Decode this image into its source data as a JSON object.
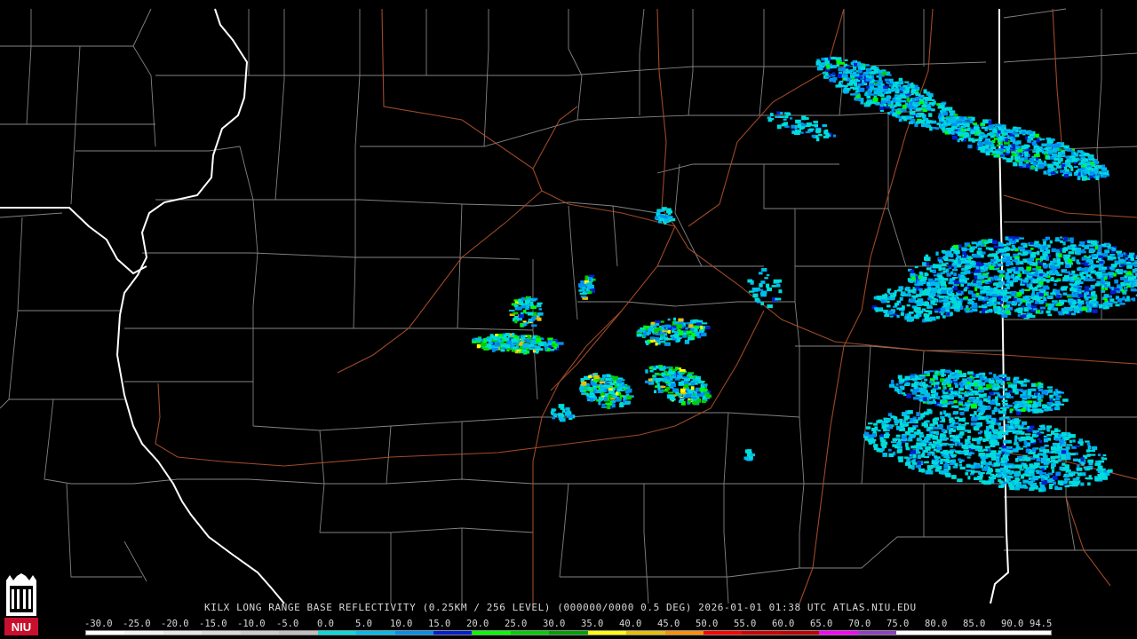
{
  "product": {
    "caption": "KILX LONG RANGE BASE REFLECTIVITY (0.25KM / 256 LEVEL) (000000/0000 0.5 DEG) 2026-01-01 01:38 UTC  ATLAS.NIU.EDU"
  },
  "scale": {
    "labels": [
      "-30.0",
      "-25.0",
      "-20.0",
      "-15.0",
      "-10.0",
      "-5.0",
      "0.0",
      "5.0",
      "10.0",
      "15.0",
      "20.0",
      "25.0",
      "30.0",
      "35.0",
      "40.0",
      "45.0",
      "50.0",
      "55.0",
      "60.0",
      "65.0",
      "70.0",
      "75.0",
      "80.0",
      "85.0",
      "90.0",
      "94.5"
    ],
    "colors": [
      "#ffffff",
      "#f2f2f2",
      "#e6e6e6",
      "#d9d9d9",
      "#cccccc",
      "#c0c0c0",
      "#00dcdc",
      "#00bcec",
      "#0090f0",
      "#0020d0",
      "#00ff00",
      "#00d000",
      "#00a000",
      "#ffff00",
      "#e8c000",
      "#ff9000",
      "#ff0000",
      "#d00000",
      "#c00000",
      "#ff00ff",
      "#9040c0",
      "#ffffff",
      "#ffffff",
      "#ffffff",
      "#ffffff"
    ]
  },
  "logo": {
    "text": "NIU"
  },
  "map": {
    "state_line_color": "#ffffff",
    "county_line_color": "#9a9a9a",
    "highway_color": "#b0522a"
  }
}
